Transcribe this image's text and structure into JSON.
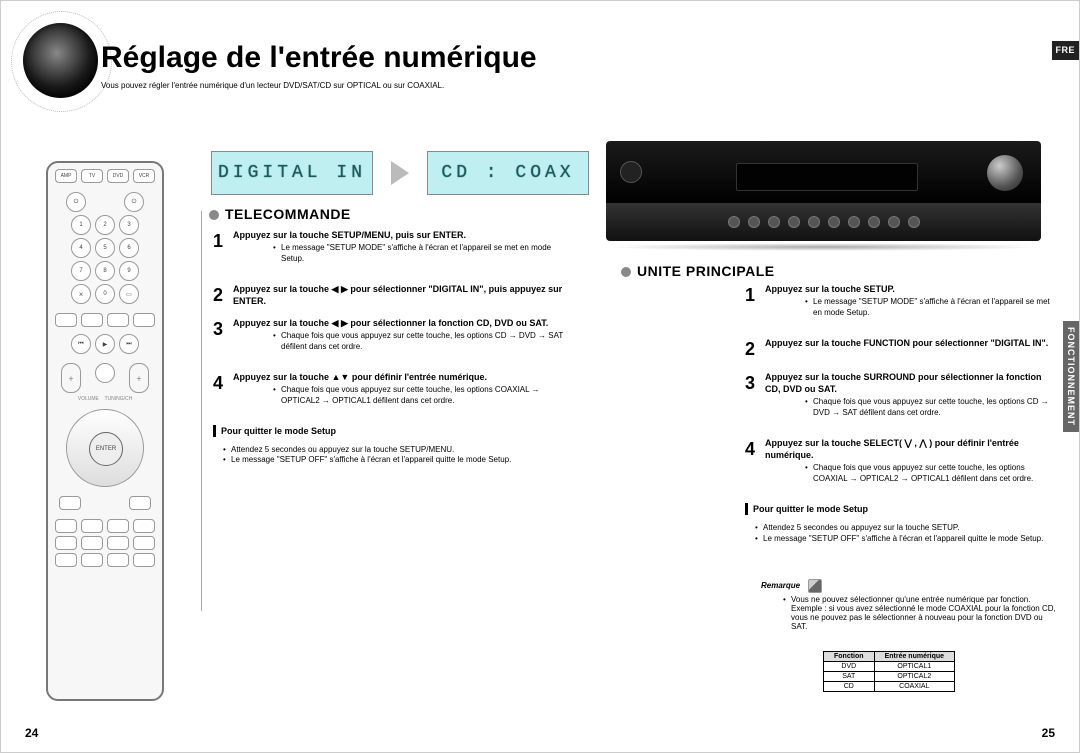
{
  "lang_tab": "FRE",
  "side_tab": "FONCTIONNEMENT",
  "title": "Réglage de l'entrée numérique",
  "subtitle": "Vous pouvez régler l'entrée numérique d'un lecteur DVD/SAT/CD sur OPTICAL ou sur COAXIAL.",
  "lcd1": "DIGITAL IN",
  "lcd2": "CD : COAX",
  "remote": {
    "enter_label": "ENTER"
  },
  "telecommande": {
    "heading": "TELECOMMANDE",
    "steps": [
      {
        "num": "1",
        "main": "Appuyez sur la touche SETUP/MENU, puis sur ENTER.",
        "subs": [
          "Le message \"SETUP MODE\" s'affiche à l'écran et l'appareil se met en mode Setup."
        ]
      },
      {
        "num": "2",
        "main": "Appuyez sur la touche ◀ ▶ pour sélectionner \"DIGITAL IN\", puis appuyez sur ENTER.",
        "subs": []
      },
      {
        "num": "3",
        "main": "Appuyez sur la touche ◀ ▶ pour sélectionner la fonction CD, DVD ou SAT.",
        "subs": [
          "Chaque fois que vous appuyez sur cette touche, les options CD → DVD → SAT défilent dans cet ordre."
        ]
      },
      {
        "num": "4",
        "main": "Appuyez sur la touche ▲▼ pour définir l'entrée numérique.",
        "subs": [
          "Chaque fois que vous appuyez sur cette touche, les options COAXIAL → OPTICAL2 → OPTICAL1 défilent dans cet ordre."
        ]
      }
    ],
    "exit_head": "Pour quitter le mode Setup",
    "exit_subs": [
      "Attendez 5 secondes ou appuyez sur la touche SETUP/MENU.",
      "Le message \"SETUP OFF\" s'affiche à l'écran et l'appareil quitte le mode Setup."
    ]
  },
  "unite": {
    "heading": "UNITE PRINCIPALE",
    "steps": [
      {
        "num": "1",
        "main": "Appuyez sur la touche SETUP.",
        "subs": [
          "Le message \"SETUP MODE\" s'affiche à l'écran et l'appareil se met en mode Setup."
        ]
      },
      {
        "num": "2",
        "main": "Appuyez sur la touche FUNCTION pour sélectionner \"DIGITAL IN\".",
        "subs": []
      },
      {
        "num": "3",
        "main": "Appuyez sur la touche SURROUND pour sélectionner la fonction CD, DVD ou SAT.",
        "subs": [
          "Chaque fois que vous appuyez sur cette touche, les options CD → DVD → SAT défilent dans cet ordre."
        ]
      },
      {
        "num": "4",
        "main": "Appuyez sur la touche SELECT( ⋁ , ⋀ ) pour définir l'entrée numérique.",
        "subs": [
          "Chaque fois que vous appuyez sur cette touche, les options COAXIAL → OPTICAL2 → OPTICAL1 défilent dans cet ordre."
        ]
      }
    ],
    "exit_head": "Pour quitter le mode Setup",
    "exit_subs": [
      "Attendez 5 secondes ou appuyez sur la touche SETUP.",
      "Le message \"SETUP OFF\" s'affiche à l'écran et l'appareil quitte le mode Setup."
    ]
  },
  "note": {
    "tag": "Remarque",
    "text": "Vous ne pouvez sélectionner qu'une entrée numérique par fonction. Exemple : si vous avez sélectionné le mode COAXIAL pour la fonction CD, vous ne pouvez pas le sélectionner à nouveau pour la fonction DVD ou SAT."
  },
  "table": {
    "h1": "Fonction",
    "h2": "Entrée numérique",
    "rows": [
      {
        "f": "DVD",
        "e": "OPTICAL1"
      },
      {
        "f": "SAT",
        "e": "OPTICAL2"
      },
      {
        "f": "CD",
        "e": "COAXIAL"
      }
    ]
  },
  "page_left": "24",
  "page_right": "25"
}
